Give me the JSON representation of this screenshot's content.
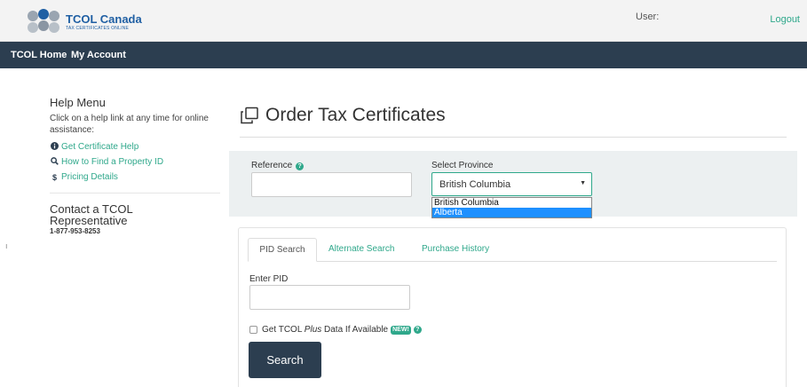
{
  "header": {
    "brand_title": "TCOL Canada",
    "brand_subtitle": "TAX CERTIFICATES ONLINE",
    "user_label": "User:",
    "logout_label": "Logout"
  },
  "nav": {
    "items": [
      {
        "label": "TCOL Home"
      },
      {
        "label": "My Account"
      }
    ]
  },
  "sidebar": {
    "help_title": "Help Menu",
    "help_desc": "Click on a help link at any time for online assistance:",
    "links": [
      {
        "label": "Get Certificate Help",
        "icon": "info-circle-icon"
      },
      {
        "label": "How to Find a Property ID",
        "icon": "search-icon"
      },
      {
        "label": "Pricing Details",
        "icon": "dollar-icon"
      }
    ],
    "contact_title": "Contact a TCOL Representative",
    "contact_phone": "1-877-953-8253"
  },
  "margin_mark": "ı",
  "main": {
    "page_title": "Order Tax Certificates",
    "reference_label": "Reference",
    "province_label": "Select Province",
    "province_selected": "British Columbia",
    "province_options": [
      {
        "label": "British Columbia",
        "highlighted": false
      },
      {
        "label": "Alberta",
        "highlighted": true
      }
    ],
    "tabs": [
      {
        "label": "PID Search",
        "active": true
      },
      {
        "label": "Alternate Search",
        "active": false
      },
      {
        "label": "Purchase History",
        "active": false
      }
    ],
    "pid_label": "Enter PID",
    "plus_prefix": "Get TCOL ",
    "plus_italic": "Plus",
    "plus_suffix": " Data If Available",
    "new_badge": "NEW!",
    "search_button": "Search"
  },
  "colors": {
    "accent": "#2fa88b",
    "navbar": "#2c3e50",
    "panel_bg": "#ecf0f1",
    "dropdown_highlight": "#1e90ff"
  }
}
